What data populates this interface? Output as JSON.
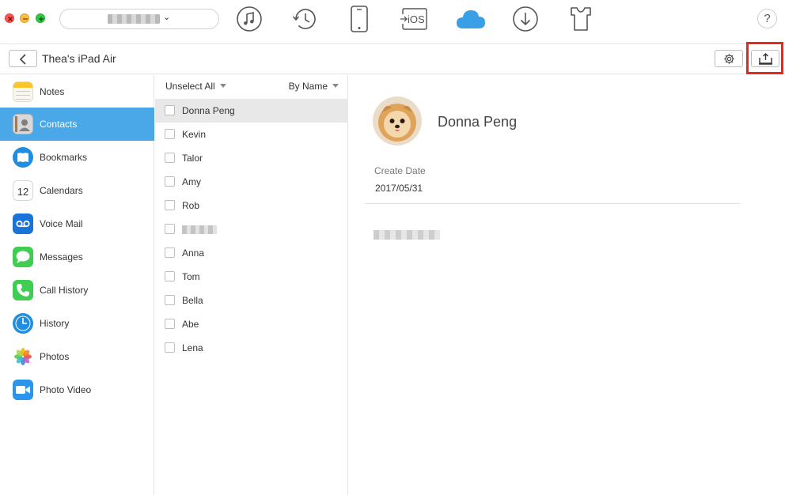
{
  "toolbar": {
    "tools": [
      {
        "icon": "music-icon",
        "active": false
      },
      {
        "icon": "history-clock-icon",
        "active": false
      },
      {
        "icon": "phone-device-icon",
        "active": false
      },
      {
        "icon": "transfer-to-ios-icon",
        "label": "iOS",
        "active": false
      },
      {
        "icon": "icloud-icon",
        "active": true,
        "color": "#3aa0e6"
      },
      {
        "icon": "download-icon",
        "active": false
      },
      {
        "icon": "tshirt-icon",
        "active": false
      }
    ],
    "help_label": "?"
  },
  "subbar": {
    "device_title": "Thea's iPad Air"
  },
  "sidebar": {
    "active_color": "#4aa8e8",
    "items": [
      {
        "label": "Notes",
        "icon": "notes-icon",
        "active": false
      },
      {
        "label": "Contacts",
        "icon": "contacts-icon",
        "active": true
      },
      {
        "label": "Bookmarks",
        "icon": "bookmarks-icon",
        "active": false
      },
      {
        "label": "Calendars",
        "icon": "calendar-icon",
        "active": false
      },
      {
        "label": "Voice Mail",
        "icon": "voicemail-icon",
        "active": false
      },
      {
        "label": "Messages",
        "icon": "messages-icon",
        "active": false
      },
      {
        "label": "Call History",
        "icon": "phone-icon",
        "active": false
      },
      {
        "label": "History",
        "icon": "clock-icon",
        "active": false
      },
      {
        "label": "Photos",
        "icon": "photos-icon",
        "active": false
      },
      {
        "label": "Photo Video",
        "icon": "video-icon",
        "active": false
      }
    ],
    "calendar_day": "12"
  },
  "list": {
    "unselect_label": "Unselect All",
    "sort_label": "By Name",
    "contacts": [
      {
        "name": "Donna Peng",
        "selected": true
      },
      {
        "name": "Kevin",
        "selected": false
      },
      {
        "name": "Talor",
        "selected": false
      },
      {
        "name": "Amy",
        "selected": false
      },
      {
        "name": "Rob",
        "selected": false
      },
      {
        "name": "",
        "selected": false
      },
      {
        "name": "Anna",
        "selected": false
      },
      {
        "name": "Tom",
        "selected": false
      },
      {
        "name": "Bella",
        "selected": false
      },
      {
        "name": "Abe",
        "selected": false
      },
      {
        "name": "Lena",
        "selected": false
      }
    ]
  },
  "detail": {
    "name": "Donna Peng",
    "create_date_label": "Create Date",
    "create_date_value": "2017/05/31"
  },
  "colors": {
    "highlight": "#e8261c",
    "close": "#fc5753",
    "minimize": "#fdbc40",
    "maximize": "#33c748"
  }
}
